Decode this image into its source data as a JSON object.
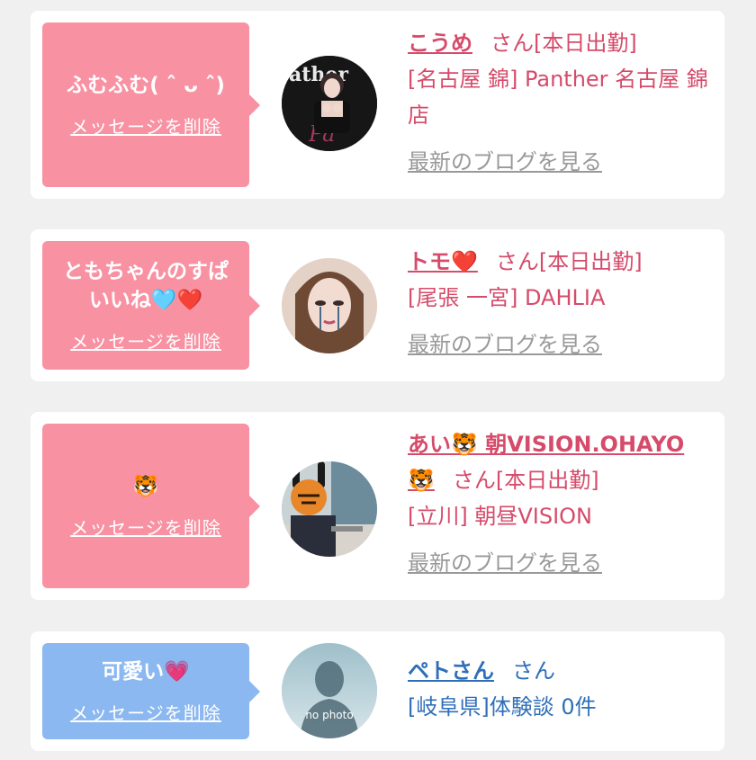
{
  "cards": [
    {
      "message": "ふむふむ( ˆ ᴗ ˆ)",
      "delete_label": "メッセージを削除",
      "name": "こうめ",
      "san": "さん",
      "status": "[本日出勤]",
      "shop": "[名古屋 錦] Panther 名古屋 錦店",
      "blog_label": "最新のブログを見る",
      "bubble_color": "#f892a3"
    },
    {
      "message": "ともちゃんのすぱいいね🩵❤️",
      "delete_label": "メッセージを削除",
      "name": "トモ❤️",
      "san": "さん",
      "status": "[本日出勤]",
      "shop": "[尾張 一宮] DAHLIA",
      "blog_label": "最新のブログを見る",
      "bubble_color": "#f892a3"
    },
    {
      "message": "🐯",
      "delete_label": "メッセージを削除",
      "name": "あい🐯 朝VISION.OHAYO 🐯",
      "san": "さん",
      "status": "[本日出勤]",
      "shop": "[立川] 朝昼VISION",
      "blog_label": "最新のブログを見る",
      "bubble_color": "#f892a3"
    },
    {
      "message": "可愛い💗",
      "delete_label": "メッセージを削除",
      "name": "ペトさん",
      "san": "さん",
      "detail": "[岐阜県]体験談 0件",
      "avatar_text": "no photo",
      "bubble_color": "#8bb8f0"
    }
  ],
  "colors": {
    "accent_pink": "#d64b6a",
    "accent_blue": "#2f6fb8",
    "link_gray": "#999999"
  }
}
